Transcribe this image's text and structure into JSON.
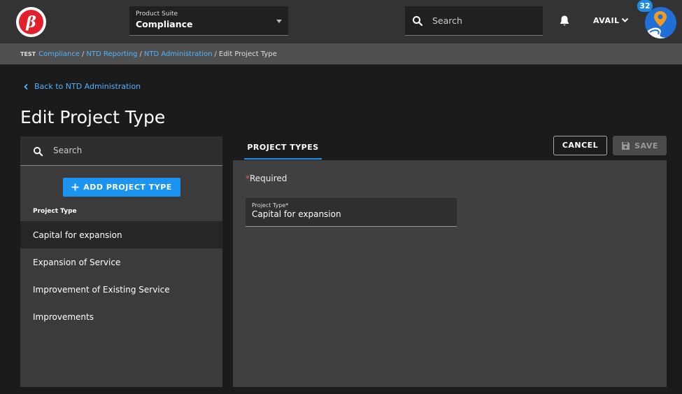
{
  "header": {
    "logo_letter": "β",
    "product_suite": {
      "label": "Product Suite",
      "value": "Compliance"
    },
    "search_placeholder": "Search",
    "org_name": "AVAIL",
    "notification_count": "32"
  },
  "breadcrumb": {
    "env": "TEST",
    "links": [
      "Compliance",
      "NTD Reporting",
      "NTD Administration"
    ],
    "current": "Edit Project Type",
    "separator": "/"
  },
  "back_link": "Back to NTD Administration",
  "page_title": "Edit Project Type",
  "sidebar": {
    "search_placeholder": "Search",
    "add_button": "ADD PROJECT TYPE",
    "column_header": "Project Type",
    "items": [
      {
        "label": "Capital for expansion",
        "selected": true
      },
      {
        "label": "Expansion of Service",
        "selected": false
      },
      {
        "label": "Improvement of Existing Service",
        "selected": false
      },
      {
        "label": "Improvements",
        "selected": false
      }
    ]
  },
  "tabs": [
    {
      "label": "PROJECT TYPES",
      "active": true
    }
  ],
  "actions": {
    "cancel": "CANCEL",
    "save": "SAVE"
  },
  "form": {
    "required_star": "*",
    "required_text": "Required",
    "field": {
      "label": "Project Type*",
      "value": "Capital for expansion"
    }
  },
  "colors": {
    "accent": "#1a94f0",
    "link": "#4fb3ff",
    "logo_red": "#e21f2b"
  }
}
